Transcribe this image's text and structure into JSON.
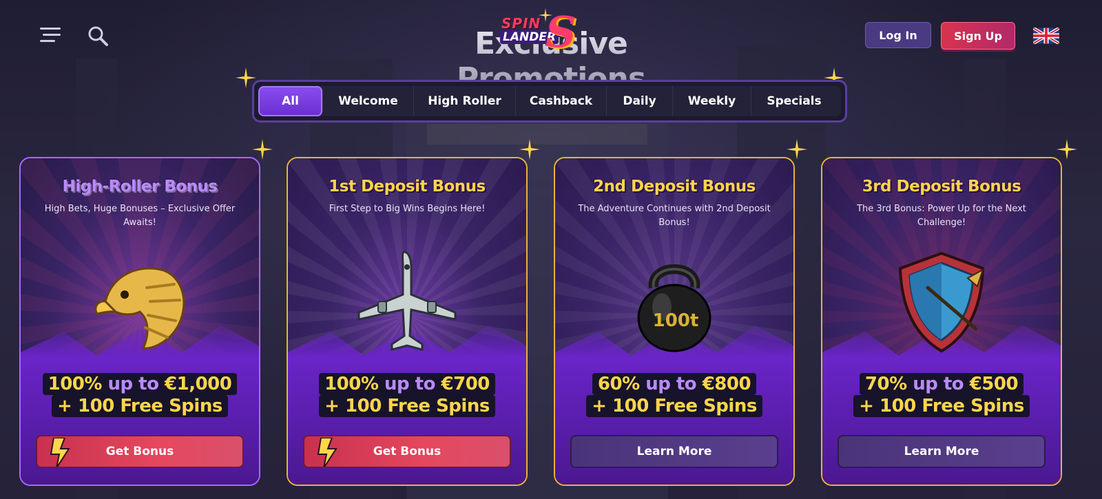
{
  "header": {
    "page_title": "Exclusive Promotions",
    "logo": {
      "line1": "SPIN",
      "line2": "LANDER",
      "mark": "S"
    },
    "menu_icon": "hamburger-icon",
    "search_icon": "search-icon",
    "login_label": "Log In",
    "signup_label": "Sign Up",
    "language_icon": "uk-flag-icon"
  },
  "tabs": [
    {
      "label": "All",
      "active": true
    },
    {
      "label": "Welcome"
    },
    {
      "label": "High Roller"
    },
    {
      "label": "Cashback"
    },
    {
      "label": "Daily"
    },
    {
      "label": "Weekly"
    },
    {
      "label": "Specials"
    }
  ],
  "cards": [
    {
      "title": "High-Roller Bonus",
      "subtitle": "High Bets, Huge Bonuses – Exclusive Offer Awaits!",
      "art": "eagle-icon",
      "offer_pct": "100%",
      "offer_upto": "up to",
      "offer_amount": "€1,000",
      "offer_spins": "+ 100 Free Spins",
      "button": "Get Bonus"
    },
    {
      "title": "1st Deposit Bonus",
      "subtitle": "First Step to Big Wins Begins Here!",
      "art": "airplane-icon",
      "offer_pct": "100%",
      "offer_upto": "up to",
      "offer_amount": "€700",
      "offer_spins": "+ 100 Free Spins",
      "button": "Get Bonus"
    },
    {
      "title": "2nd Deposit Bonus",
      "subtitle": "The Adventure Continues with 2nd Deposit Bonus!",
      "art": "kettlebell-icon",
      "art_text": "100t",
      "offer_pct": "60%",
      "offer_upto": "up to",
      "offer_amount": "€800",
      "offer_spins": "+ 100 Free Spins",
      "button": "Learn More"
    },
    {
      "title": "3rd Deposit Bonus",
      "subtitle": "The 3rd Bonus: Power Up for the Next Challenge!",
      "art": "shield-icon",
      "offer_pct": "70%",
      "offer_upto": "up to",
      "offer_amount": "€500",
      "offer_spins": "+ 100 Free Spins",
      "button": "Learn More"
    }
  ],
  "colors": {
    "gold": "#ffd64a",
    "violet": "#b98bff",
    "primary_button": "#d83c56",
    "secondary_button": "#4f3882",
    "tab_active": "#7a3de8"
  }
}
